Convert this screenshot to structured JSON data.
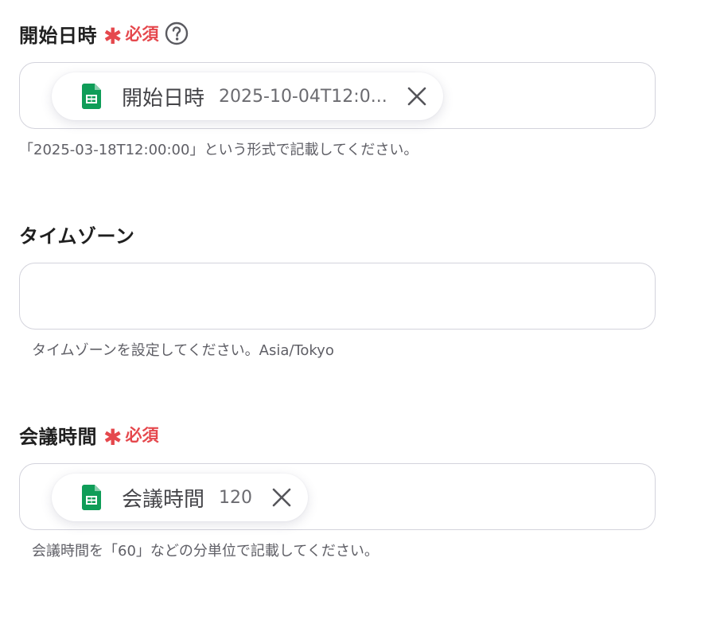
{
  "fields": [
    {
      "label": "開始日時",
      "required_mark": "✱",
      "required_text": "必須",
      "help_icon": "question-circle-icon",
      "chip": {
        "icon": "google-sheets-icon",
        "name": "開始日時",
        "value": "2025-10-04T12:0...",
        "close_icon": "close-icon"
      },
      "hint": "「2025-03-18T12:00:00」という形式で記載してください。"
    },
    {
      "label": "タイムゾーン",
      "value": "",
      "hint": "タイムゾーンを設定してください。Asia/Tokyo"
    },
    {
      "label": "会議時間",
      "required_mark": "✱",
      "required_text": "必須",
      "chip": {
        "icon": "google-sheets-icon",
        "name": "会議時間",
        "value": "120",
        "close_icon": "close-icon"
      },
      "hint": "会議時間を「60」などの分単位で記載してください。"
    }
  ],
  "colors": {
    "required": "#e5484d",
    "border": "#d3d3dc",
    "sheets_green": "#0f9d58",
    "hint_text": "#5f5f66"
  }
}
